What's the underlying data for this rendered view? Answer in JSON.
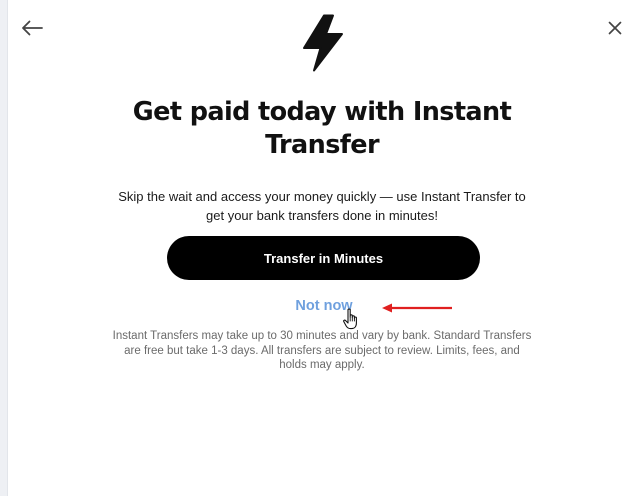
{
  "header": {
    "back_icon": "arrow-left-icon",
    "close_icon": "close-icon"
  },
  "hero": {
    "icon": "lightning-bolt-icon",
    "headline": "Get paid today with Instant Transfer",
    "subtext": "Skip the wait and access your money quickly — use Instant Transfer to get your bank transfers done in minutes!"
  },
  "actions": {
    "primary_label": "Transfer in Minutes",
    "secondary_label": "Not now"
  },
  "disclaimer": "Instant Transfers may take up to 30 minutes and vary by bank. Standard Transfers are free but take 1-3 days. All transfers are subject to review. Limits, fees, and holds may apply.",
  "annotations": {
    "arrow_icon": "red-arrow-icon",
    "cursor_icon": "hand-pointer-icon",
    "arrow_color": "#e02020"
  },
  "colors": {
    "primary_button_bg": "#000000",
    "link": "#6fa0de",
    "text": "#111111",
    "muted_text": "#6b6b6b"
  }
}
